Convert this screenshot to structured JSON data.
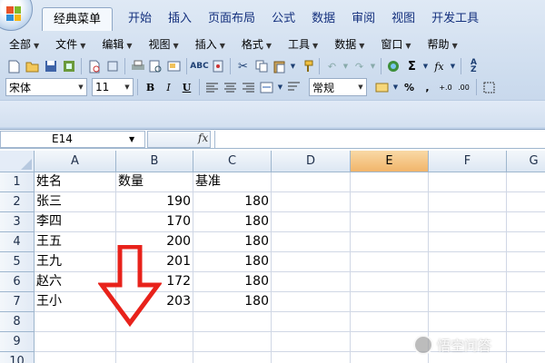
{
  "ribbon": {
    "tabs": [
      "经典菜单",
      "开始",
      "插入",
      "页面布局",
      "公式",
      "数据",
      "审阅",
      "视图",
      "开发工具"
    ],
    "active_tab_index": 0,
    "menus": [
      "全部",
      "文件",
      "编辑",
      "视图",
      "插入",
      "格式",
      "工具",
      "数据",
      "窗口",
      "帮助"
    ]
  },
  "toolbar": {
    "font_name": "宋体",
    "font_size": "11",
    "bold_label": "B",
    "italic_label": "I",
    "underline_label": "U",
    "number_format": "常规",
    "percent_label": "%",
    "comma_label": ",",
    "sigma_label": "Σ",
    "fx_label": "fx"
  },
  "formula_bar": {
    "name_box": "E14",
    "fx_label": "fx",
    "formula": ""
  },
  "sheet": {
    "columns": [
      "A",
      "B",
      "C",
      "D",
      "E",
      "F",
      "G"
    ],
    "selected_column": "E",
    "rows": [
      "1",
      "2",
      "3",
      "4",
      "5",
      "6",
      "7",
      "8",
      "9",
      "10"
    ],
    "cells": [
      [
        "姓名",
        "数量",
        "基准"
      ],
      [
        "张三",
        "190",
        "180"
      ],
      [
        "李四",
        "170",
        "180"
      ],
      [
        "王五",
        "200",
        "180"
      ],
      [
        "王九",
        "201",
        "180"
      ],
      [
        "赵六",
        "172",
        "180"
      ],
      [
        "王小",
        "203",
        "180"
      ]
    ]
  },
  "watermark": {
    "text": "悟空问答"
  },
  "colors": {
    "arrow": "#e8221b",
    "selected_header": "#f1b56a",
    "ribbon": "#cddcee"
  }
}
